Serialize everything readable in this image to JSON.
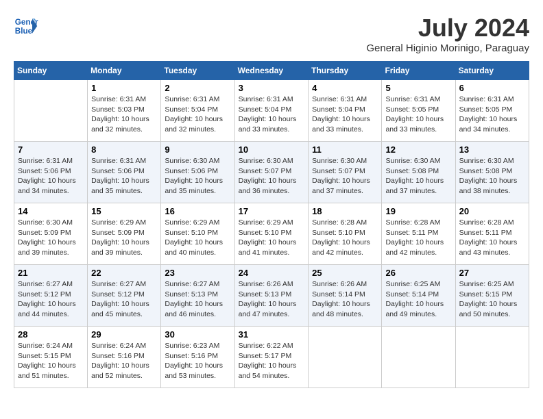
{
  "header": {
    "logo_text_general": "General",
    "logo_text_blue": "Blue",
    "month_year": "July 2024",
    "location": "General Higinio Morinigo, Paraguay"
  },
  "weekdays": [
    "Sunday",
    "Monday",
    "Tuesday",
    "Wednesday",
    "Thursday",
    "Friday",
    "Saturday"
  ],
  "weeks": [
    [
      {
        "day": "",
        "sunrise": "",
        "sunset": "",
        "daylight": ""
      },
      {
        "day": "1",
        "sunrise": "Sunrise: 6:31 AM",
        "sunset": "Sunset: 5:03 PM",
        "daylight": "Daylight: 10 hours and 32 minutes."
      },
      {
        "day": "2",
        "sunrise": "Sunrise: 6:31 AM",
        "sunset": "Sunset: 5:04 PM",
        "daylight": "Daylight: 10 hours and 32 minutes."
      },
      {
        "day": "3",
        "sunrise": "Sunrise: 6:31 AM",
        "sunset": "Sunset: 5:04 PM",
        "daylight": "Daylight: 10 hours and 33 minutes."
      },
      {
        "day": "4",
        "sunrise": "Sunrise: 6:31 AM",
        "sunset": "Sunset: 5:04 PM",
        "daylight": "Daylight: 10 hours and 33 minutes."
      },
      {
        "day": "5",
        "sunrise": "Sunrise: 6:31 AM",
        "sunset": "Sunset: 5:05 PM",
        "daylight": "Daylight: 10 hours and 33 minutes."
      },
      {
        "day": "6",
        "sunrise": "Sunrise: 6:31 AM",
        "sunset": "Sunset: 5:05 PM",
        "daylight": "Daylight: 10 hours and 34 minutes."
      }
    ],
    [
      {
        "day": "7",
        "sunrise": "Sunrise: 6:31 AM",
        "sunset": "Sunset: 5:06 PM",
        "daylight": "Daylight: 10 hours and 34 minutes."
      },
      {
        "day": "8",
        "sunrise": "Sunrise: 6:31 AM",
        "sunset": "Sunset: 5:06 PM",
        "daylight": "Daylight: 10 hours and 35 minutes."
      },
      {
        "day": "9",
        "sunrise": "Sunrise: 6:30 AM",
        "sunset": "Sunset: 5:06 PM",
        "daylight": "Daylight: 10 hours and 35 minutes."
      },
      {
        "day": "10",
        "sunrise": "Sunrise: 6:30 AM",
        "sunset": "Sunset: 5:07 PM",
        "daylight": "Daylight: 10 hours and 36 minutes."
      },
      {
        "day": "11",
        "sunrise": "Sunrise: 6:30 AM",
        "sunset": "Sunset: 5:07 PM",
        "daylight": "Daylight: 10 hours and 37 minutes."
      },
      {
        "day": "12",
        "sunrise": "Sunrise: 6:30 AM",
        "sunset": "Sunset: 5:08 PM",
        "daylight": "Daylight: 10 hours and 37 minutes."
      },
      {
        "day": "13",
        "sunrise": "Sunrise: 6:30 AM",
        "sunset": "Sunset: 5:08 PM",
        "daylight": "Daylight: 10 hours and 38 minutes."
      }
    ],
    [
      {
        "day": "14",
        "sunrise": "Sunrise: 6:30 AM",
        "sunset": "Sunset: 5:09 PM",
        "daylight": "Daylight: 10 hours and 39 minutes."
      },
      {
        "day": "15",
        "sunrise": "Sunrise: 6:29 AM",
        "sunset": "Sunset: 5:09 PM",
        "daylight": "Daylight: 10 hours and 39 minutes."
      },
      {
        "day": "16",
        "sunrise": "Sunrise: 6:29 AM",
        "sunset": "Sunset: 5:10 PM",
        "daylight": "Daylight: 10 hours and 40 minutes."
      },
      {
        "day": "17",
        "sunrise": "Sunrise: 6:29 AM",
        "sunset": "Sunset: 5:10 PM",
        "daylight": "Daylight: 10 hours and 41 minutes."
      },
      {
        "day": "18",
        "sunrise": "Sunrise: 6:28 AM",
        "sunset": "Sunset: 5:10 PM",
        "daylight": "Daylight: 10 hours and 42 minutes."
      },
      {
        "day": "19",
        "sunrise": "Sunrise: 6:28 AM",
        "sunset": "Sunset: 5:11 PM",
        "daylight": "Daylight: 10 hours and 42 minutes."
      },
      {
        "day": "20",
        "sunrise": "Sunrise: 6:28 AM",
        "sunset": "Sunset: 5:11 PM",
        "daylight": "Daylight: 10 hours and 43 minutes."
      }
    ],
    [
      {
        "day": "21",
        "sunrise": "Sunrise: 6:27 AM",
        "sunset": "Sunset: 5:12 PM",
        "daylight": "Daylight: 10 hours and 44 minutes."
      },
      {
        "day": "22",
        "sunrise": "Sunrise: 6:27 AM",
        "sunset": "Sunset: 5:12 PM",
        "daylight": "Daylight: 10 hours and 45 minutes."
      },
      {
        "day": "23",
        "sunrise": "Sunrise: 6:27 AM",
        "sunset": "Sunset: 5:13 PM",
        "daylight": "Daylight: 10 hours and 46 minutes."
      },
      {
        "day": "24",
        "sunrise": "Sunrise: 6:26 AM",
        "sunset": "Sunset: 5:13 PM",
        "daylight": "Daylight: 10 hours and 47 minutes."
      },
      {
        "day": "25",
        "sunrise": "Sunrise: 6:26 AM",
        "sunset": "Sunset: 5:14 PM",
        "daylight": "Daylight: 10 hours and 48 minutes."
      },
      {
        "day": "26",
        "sunrise": "Sunrise: 6:25 AM",
        "sunset": "Sunset: 5:14 PM",
        "daylight": "Daylight: 10 hours and 49 minutes."
      },
      {
        "day": "27",
        "sunrise": "Sunrise: 6:25 AM",
        "sunset": "Sunset: 5:15 PM",
        "daylight": "Daylight: 10 hours and 50 minutes."
      }
    ],
    [
      {
        "day": "28",
        "sunrise": "Sunrise: 6:24 AM",
        "sunset": "Sunset: 5:15 PM",
        "daylight": "Daylight: 10 hours and 51 minutes."
      },
      {
        "day": "29",
        "sunrise": "Sunrise: 6:24 AM",
        "sunset": "Sunset: 5:16 PM",
        "daylight": "Daylight: 10 hours and 52 minutes."
      },
      {
        "day": "30",
        "sunrise": "Sunrise: 6:23 AM",
        "sunset": "Sunset: 5:16 PM",
        "daylight": "Daylight: 10 hours and 53 minutes."
      },
      {
        "day": "31",
        "sunrise": "Sunrise: 6:22 AM",
        "sunset": "Sunset: 5:17 PM",
        "daylight": "Daylight: 10 hours and 54 minutes."
      },
      {
        "day": "",
        "sunrise": "",
        "sunset": "",
        "daylight": ""
      },
      {
        "day": "",
        "sunrise": "",
        "sunset": "",
        "daylight": ""
      },
      {
        "day": "",
        "sunrise": "",
        "sunset": "",
        "daylight": ""
      }
    ]
  ]
}
